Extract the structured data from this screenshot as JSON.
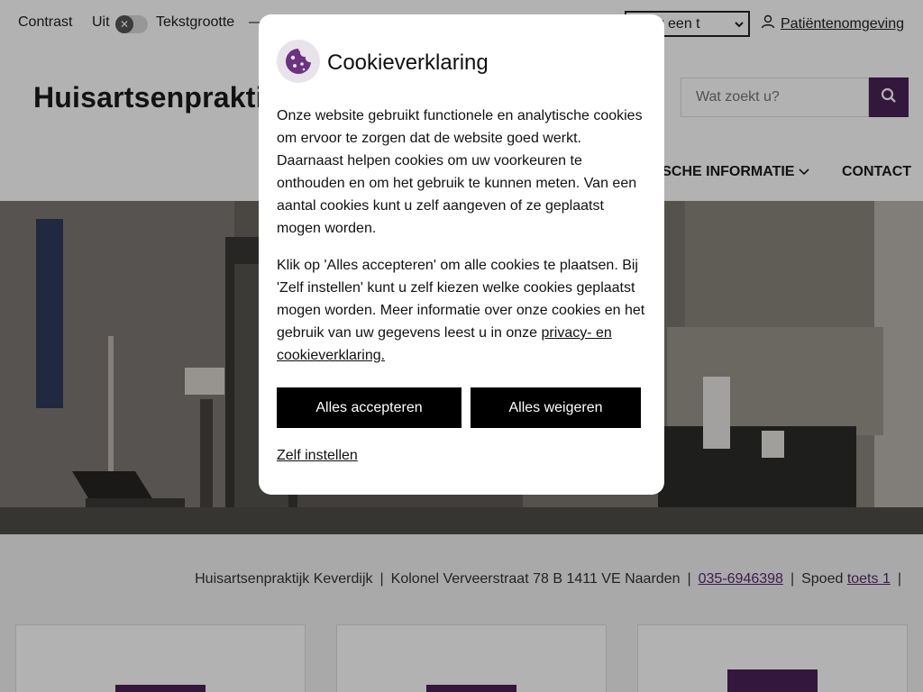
{
  "topbar": {
    "contrast_label": "Contrast",
    "contrast_state": "Uit",
    "toggle_glyph": "✕",
    "textsize_label": "Tekstgrootte",
    "textsize_minus": "—",
    "language_select_value": "cteer een t",
    "portal_link": "Patiëntenomgeving"
  },
  "header": {
    "site_title": "Huisartsenpraktijk Keverdijk",
    "search_placeholder": "Wat zoekt u?",
    "nav": {
      "info_label": "TISCHE INFORMATIE",
      "contact_label": "CONTACT"
    }
  },
  "info_bar": {
    "practice_name": "Huisartsenpraktijk Keverdijk",
    "address": "Kolonel Verveerstraat 78 B 1411 VE  Naarden",
    "phone": "035-6946398",
    "spoed_label": "Spoed",
    "spoed_link": "toets 1",
    "separator": "|"
  },
  "cookie_modal": {
    "title": "Cookieverklaring",
    "paragraph_1": "Onze website gebruikt functionele en analytische cookies om ervoor te zorgen dat de website goed werkt. Daarnaast helpen cookies om uw voorkeuren te onthouden en om het gebruik te kunnen meten. Van een aantal cookies kunt u zelf aangeven of ze geplaatst mogen worden.",
    "paragraph_2": "Klik op 'Alles accepteren' om alle cookies te plaatsen. Bij 'Zelf instellen' kunt u zelf kiezen welke cookies geplaatst mogen worden. Meer informatie over onze cookies en het gebruik van uw gegevens leest u in onze ",
    "privacy_link": "privacy- en cookieverklaring.",
    "accept_button": "Alles accepteren",
    "reject_button": "Alles weigeren",
    "settings_link": "Zelf instellen"
  },
  "colors": {
    "brand_purple": "#4a2257",
    "link_purple": "#5a2870",
    "button_black": "#000000"
  }
}
